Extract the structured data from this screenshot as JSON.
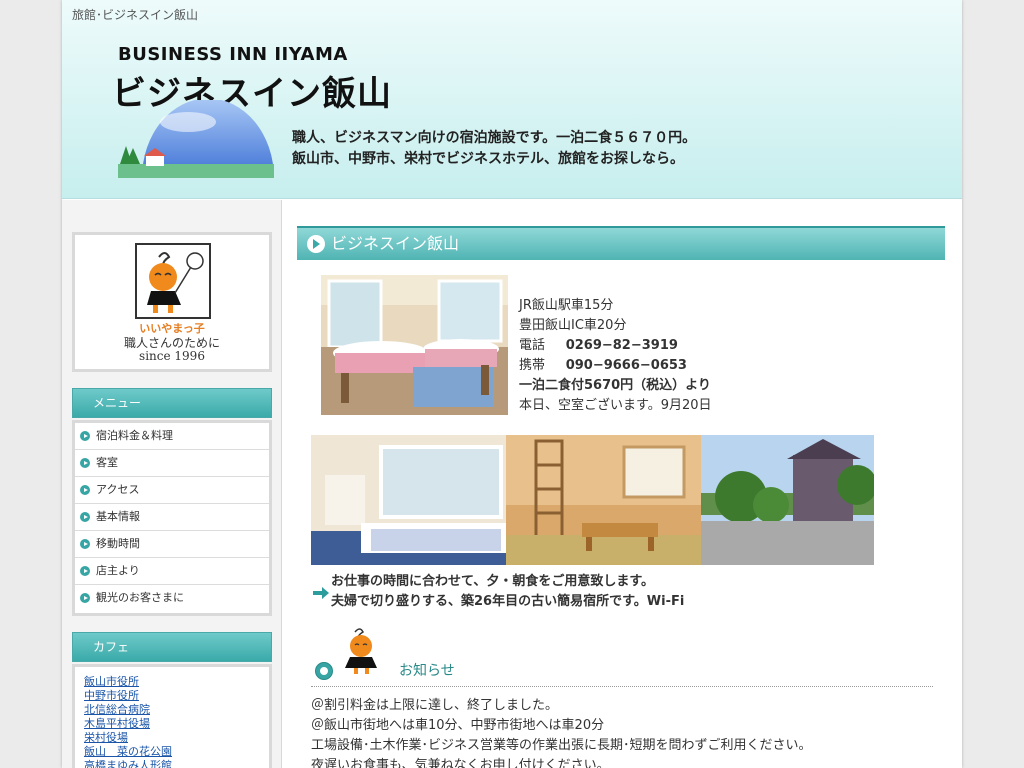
{
  "header": {
    "page_title": "旅館･ビジネスイン飯山",
    "logo_en": "BUSINESS INN IIYAMA",
    "logo_jp": "ビジネスイン飯山",
    "tagline_1": "職人、ビジネスマン向けの宿泊施設です。一泊二食５６７０円。",
    "tagline_2": "飯山市、中野市、栄村でビジネスホテル、旅館をお探しなら。"
  },
  "sidebar": {
    "mascot": {
      "name": "いいやまっ子",
      "subtitle": "職人さんのために",
      "since": "since 1996"
    },
    "menu_heading": "メニュー",
    "menu_items": [
      {
        "label": "宿泊料金＆料理"
      },
      {
        "label": "客室"
      },
      {
        "label": "アクセス"
      },
      {
        "label": "基本情報"
      },
      {
        "label": "移動時間"
      },
      {
        "label": "店主より"
      },
      {
        "label": "観光のお客さまに"
      }
    ],
    "cafe_heading": "カフェ",
    "cafe_links": [
      {
        "label": "飯山市役所"
      },
      {
        "label": "中野市役所"
      },
      {
        "label": "北信総合病院"
      },
      {
        "label": "木島平村役場"
      },
      {
        "label": "栄村役場"
      },
      {
        "label": "飯山　菜の花公園"
      },
      {
        "label": "高橋まゆみ人形館"
      }
    ]
  },
  "main": {
    "heading": "ビジネスイン飯山",
    "info": {
      "station": "JR飯山駅車15分",
      "ic": "豊田飯山IC車20分",
      "phone_label": "電話",
      "phone": "0269−82−3919",
      "mobile_label": "携帯",
      "mobile": "090−9666−0653",
      "price": "一泊二食付5670円（税込）より",
      "vacancy": "本日、空室ございます。9月20日"
    },
    "work_note_1": "お仕事の時間に合わせて、夕・朝食をご用意致します。",
    "work_note_2": "夫婦で切り盛りする、築26年目の古い簡易宿所です。Wi-Fi",
    "news": {
      "title": "お知らせ",
      "lines": [
        "＠割引料金は上限に達し、終了しました。",
        "＠飯山市街地へは車10分、中野市街地へは車20分",
        "工場設備･土木作業･ビジネス営業等の作業出張に長期･短期を問わずご利用ください。",
        "夜遅いお食事も、気兼ねなくお申し付けください。"
      ]
    }
  },
  "colors": {
    "accent": "#3aaaa9",
    "link": "#1a55a8",
    "mascot_orange": "#f08a1c"
  }
}
